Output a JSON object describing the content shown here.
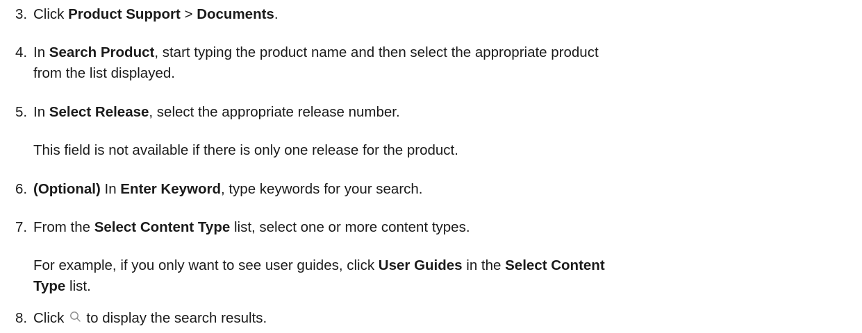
{
  "steps": [
    {
      "number": "3.",
      "parts": [
        "Click ",
        "Product Support",
        " > ",
        "Documents",
        "."
      ]
    },
    {
      "number": "4.",
      "parts": [
        "In ",
        "Search Product",
        ", start typing the product name and then select the appropriate product"
      ],
      "line2": "from the list displayed."
    },
    {
      "number": "5.",
      "parts": [
        "In ",
        "Select Release",
        ", select the appropriate release number."
      ],
      "note": "This field is not available if there is only one release for the product."
    },
    {
      "number": "6.",
      "parts": [
        "(Optional)",
        " In ",
        "Enter Keyword",
        ", type keywords for your search."
      ]
    },
    {
      "number": "7.",
      "parts": [
        "From the ",
        "Select Content Type",
        " list, select one or more content types."
      ],
      "note_line1": [
        "For example, if you only want to see user guides, click ",
        "User Guides",
        " in the ",
        "Select Content"
      ],
      "note_line2": [
        "Type",
        " list."
      ]
    },
    {
      "number": "8.",
      "parts": [
        "Click",
        "to display the search results."
      ],
      "icon": "search-icon"
    }
  ]
}
